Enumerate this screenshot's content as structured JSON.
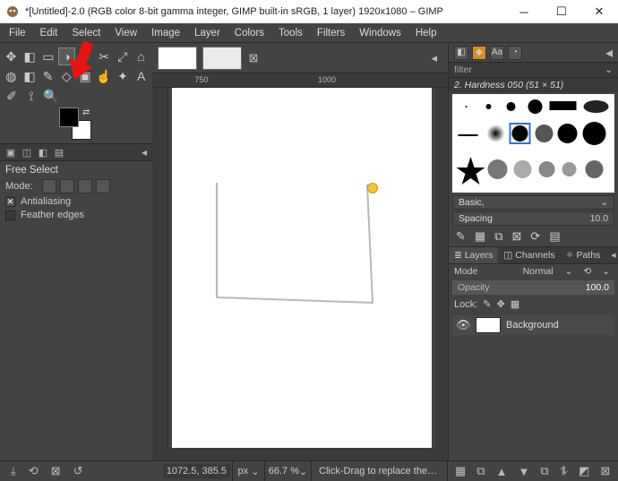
{
  "window": {
    "title": "*[Untitled]-2.0 (RGB color 8-bit gamma integer, GIMP built-in sRGB, 1 layer) 1920x1080 – GIMP"
  },
  "menu": [
    "File",
    "Edit",
    "Select",
    "View",
    "Image",
    "Layer",
    "Colors",
    "Tools",
    "Filters",
    "Windows",
    "Help"
  ],
  "ruler": {
    "h1": "750",
    "h2": "1000"
  },
  "tool_options": {
    "title": "Free Select",
    "mode_label": "Mode:",
    "antialias": "Antialiasing",
    "feather": "Feather edges"
  },
  "right": {
    "filter_placeholder": "filter",
    "brush_label": "2. Hardness 050 (51 × 51)",
    "basic": "Basic,",
    "spacing_label": "Spacing",
    "spacing_value": "10.0"
  },
  "layers": {
    "tabs": {
      "layers": "Layers",
      "channels": "Channels",
      "paths": "Paths"
    },
    "mode_label": "Mode",
    "mode_value": "Normal",
    "opacity_label": "Opacity",
    "opacity_value": "100.0",
    "lock_label": "Lock:",
    "bg_layer": "Background"
  },
  "status": {
    "coords": "1072.5, 385.5",
    "unit": "px",
    "zoom": "66.7 %",
    "hint": "Click-Drag to replace the…"
  }
}
